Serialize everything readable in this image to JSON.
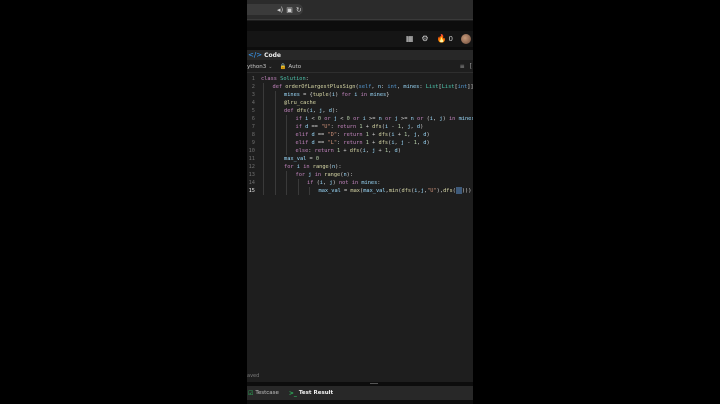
{
  "browser": {
    "url_icons": [
      "◂)",
      "▣",
      "↻"
    ]
  },
  "header": {
    "icons": [
      "▦",
      "⚙",
      "🔥"
    ],
    "fire_count": "0"
  },
  "code_tab": {
    "icon": "</>",
    "label": "Code"
  },
  "toolbar": {
    "language": "ython3",
    "language_chevron": "⌄",
    "auto_icon": "🔒",
    "auto_label": "Auto",
    "right_icons": [
      "≡",
      "["
    ]
  },
  "editor": {
    "active_line": 15,
    "lines": [
      {
        "num": "1",
        "indent": 0
      },
      {
        "num": "2",
        "indent": 1
      },
      {
        "num": "3",
        "indent": 2
      },
      {
        "num": "4",
        "indent": 2
      },
      {
        "num": "5",
        "indent": 2
      },
      {
        "num": "6",
        "indent": 3
      },
      {
        "num": "7",
        "indent": 3
      },
      {
        "num": "8",
        "indent": 3
      },
      {
        "num": "9",
        "indent": 3
      },
      {
        "num": "10",
        "indent": 3
      },
      {
        "num": "11",
        "indent": 2
      },
      {
        "num": "12",
        "indent": 2
      },
      {
        "num": "13",
        "indent": 3
      },
      {
        "num": "14",
        "indent": 4
      },
      {
        "num": "15",
        "indent": 5
      }
    ],
    "code": [
      [
        "class Solution:"
      ],
      [
        "def orderOfLargestPlusSign(self, n: int, mines: List[List[int]]) -> i"
      ],
      [
        "mines = {tuple(i) for i in mines}"
      ],
      [
        "@lru_cache"
      ],
      [
        "def dfs(i, j, d):"
      ],
      [
        "if i < 0 or j < 0 or i >= n or j >= n or (i, j) in mines: ret"
      ],
      [
        "if d == \"U\": return 1 + dfs(i - 1, j, d)"
      ],
      [
        "elif d == \"D\": return 1 + dfs(i + 1, j, d)"
      ],
      [
        "elif d == \"L\": return 1 + dfs(i, j - 1, d)"
      ],
      [
        "else: return 1 + dfs(i, j + 1, d)"
      ],
      [
        "max_val = 0"
      ],
      [
        "for i in range(n):"
      ],
      [
        "for j in range(n):"
      ],
      [
        "if (i, j) not in mines:"
      ],
      [
        "max_val = max(max_val,min(dfs(i,j,\"U\"),dfs()))"
      ]
    ]
  },
  "status": {
    "saved": "aved"
  },
  "bottom_tabs": {
    "testcase_icon": "☑",
    "testcase_label": "Testcase",
    "result_icon": ">_",
    "result_label": "Test Result"
  }
}
